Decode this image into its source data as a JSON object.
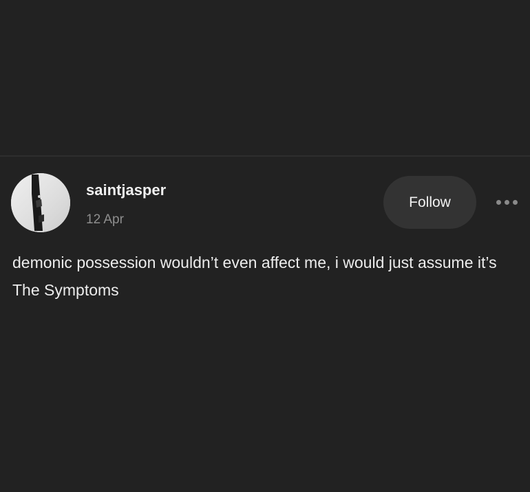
{
  "post": {
    "author": {
      "username": "saintjasper",
      "avatar_icon": "avatar-photo"
    },
    "date": "12 Apr",
    "follow_label": "Follow",
    "more_icon": "more-dots-icon",
    "text": "demonic possession wouldn’t even affect me, i would just assume it’s The Symptoms"
  },
  "colors": {
    "background": "#222222",
    "follow_button_bg": "#333333",
    "date_text": "#8e8e8e"
  }
}
